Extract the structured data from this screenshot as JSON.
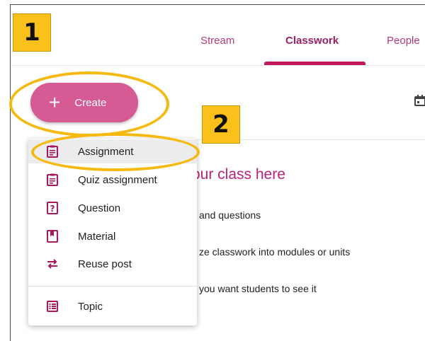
{
  "tabs": [
    {
      "label": "Stream"
    },
    {
      "label": "Classwork",
      "active": true
    },
    {
      "label": "People"
    }
  ],
  "create_button": {
    "label": "Create",
    "icon": "plus-icon"
  },
  "create_menu": {
    "items": [
      {
        "label": "Assignment",
        "icon": "assignment-icon",
        "selected": true
      },
      {
        "label": "Quiz assignment",
        "icon": "quiz-assignment-icon"
      },
      {
        "label": "Question",
        "icon": "question-icon"
      },
      {
        "label": "Material",
        "icon": "material-icon"
      },
      {
        "label": "Reuse post",
        "icon": "reuse-icon"
      },
      {
        "label": "Topic",
        "icon": "topic-icon"
      }
    ]
  },
  "hint": {
    "title": "our class here",
    "lines": [
      "and questions",
      "ze classwork into modules or units",
      "you want students to see it"
    ]
  },
  "callouts": [
    "1",
    "2"
  ],
  "colors": {
    "accent": "#c2185b",
    "button": "#d65a93",
    "highlight": "#f5b90f"
  }
}
